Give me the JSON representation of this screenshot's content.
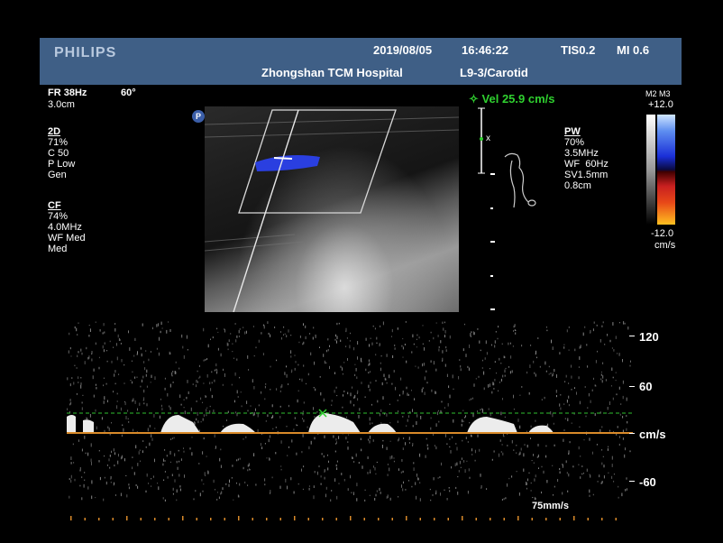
{
  "header": {
    "brand": "PHILIPS",
    "date": "2019/08/05",
    "time": "16:46:22",
    "tis": "TIS0.2",
    "mi": "MI 0.6",
    "hospital": "Zhongshan TCM Hospital",
    "probe_preset": "L9-3/Carotid"
  },
  "top_left": {
    "frame_rate": "FR 38Hz",
    "angle": "60°",
    "depth": "3.0cm"
  },
  "params_2d": {
    "heading": "2D",
    "lines": [
      "71%",
      "C 50",
      "P Low",
      "Gen"
    ]
  },
  "params_cf": {
    "heading": "CF",
    "lines": [
      "74%",
      "4.0MHz",
      "WF Med",
      "Med"
    ]
  },
  "params_pw": {
    "heading": "PW",
    "lines": [
      "70%",
      "3.5MHz",
      "WF  60Hz",
      "SV1.5mm",
      "0.8cm"
    ]
  },
  "velocity": {
    "marker": "✧",
    "label": "Vel",
    "value": "25.9 cm/s"
  },
  "color_scale": {
    "modes": "M2 M3",
    "top": "+12.0",
    "bottom": "-12.0",
    "unit": "cm/s"
  },
  "spectrum_scale": {
    "ticks": [
      "120",
      "60",
      "cm/s",
      "-60"
    ],
    "sweep_speed": "75mm/s"
  },
  "colors": {
    "header_bg": "#3f5f86",
    "velocity_green": "#2fd02f",
    "baseline_orange": "#d98a2a",
    "flow_blue": "#2a3fe0"
  },
  "icons": [
    "probe-marker-icon",
    "carotid-body-marker-icon",
    "sample-volume-cursor-icon"
  ]
}
